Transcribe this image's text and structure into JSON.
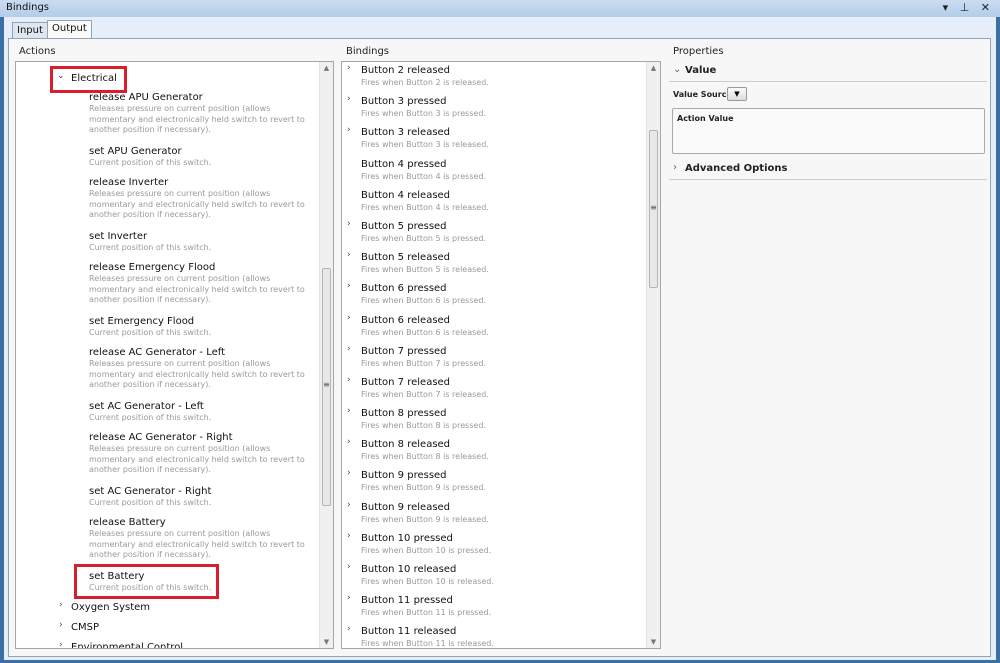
{
  "window": {
    "title": "Bindings",
    "controls": "▾ ⊥ ✕"
  },
  "tabs": [
    {
      "label": "Input"
    },
    {
      "label": "Output"
    }
  ],
  "actions": {
    "header": "Actions",
    "category": "Electrical",
    "items": [
      {
        "title": "release APU Generator",
        "desc": "Releases pressure on current position (allows momentary and electronically held switch to revert to another position if necessary).",
        "kind": "rel"
      },
      {
        "title": "set APU Generator",
        "desc": "Current position of this switch.",
        "kind": "set"
      },
      {
        "title": "release Inverter",
        "desc": "Releases pressure on current position (allows momentary and electronically held switch to revert to another position if necessary).",
        "kind": "rel"
      },
      {
        "title": "set Inverter",
        "desc": "Current position of this switch.",
        "kind": "set"
      },
      {
        "title": "release Emergency Flood",
        "desc": "Releases pressure on current position (allows momentary and electronically held switch to revert to another position if necessary).",
        "kind": "rel"
      },
      {
        "title": "set Emergency Flood",
        "desc": "Current position of this switch.",
        "kind": "set"
      },
      {
        "title": "release AC Generator - Left",
        "desc": "Releases pressure on current position (allows momentary and electronically held switch to revert to another position if necessary).",
        "kind": "rel"
      },
      {
        "title": "set AC Generator - Left",
        "desc": "Current position of this switch.",
        "kind": "set"
      },
      {
        "title": "release AC Generator - Right",
        "desc": "Releases pressure on current position (allows momentary and electronically held switch to revert to another position if necessary).",
        "kind": "rel"
      },
      {
        "title": "set AC Generator - Right",
        "desc": "Current position of this switch.",
        "kind": "set"
      },
      {
        "title": "release Battery",
        "desc": "Releases pressure on current position (allows momentary and electronically held switch to revert to another position if necessary).",
        "kind": "rel"
      },
      {
        "title": "set Battery",
        "desc": "Current position of this switch.",
        "kind": "set"
      }
    ],
    "categories_after": [
      "Oxygen System",
      "CMSP",
      "Environmental Control"
    ]
  },
  "bindings": {
    "header": "Bindings",
    "items": [
      {
        "title": "Button 2 released",
        "desc": "Fires when Button 2 is released.",
        "expandable": true
      },
      {
        "title": "Button 3 pressed",
        "desc": "Fires when Button 3 is pressed.",
        "expandable": true
      },
      {
        "title": "Button 3 released",
        "desc": "Fires when Button 3 is released.",
        "expandable": true
      },
      {
        "title": "Button 4 pressed",
        "desc": "Fires when Button 4 is pressed.",
        "expandable": false
      },
      {
        "title": "Button 4 released",
        "desc": "Fires when Button 4 is released.",
        "expandable": false
      },
      {
        "title": "Button 5 pressed",
        "desc": "Fires when Button 5 is pressed.",
        "expandable": true
      },
      {
        "title": "Button 5 released",
        "desc": "Fires when Button 5 is released.",
        "expandable": true
      },
      {
        "title": "Button 6 pressed",
        "desc": "Fires when Button 6 is pressed.",
        "expandable": true
      },
      {
        "title": "Button 6 released",
        "desc": "Fires when Button 6 is released.",
        "expandable": true
      },
      {
        "title": "Button 7 pressed",
        "desc": "Fires when Button 7 is pressed.",
        "expandable": true
      },
      {
        "title": "Button 7 released",
        "desc": "Fires when Button 7 is released.",
        "expandable": true
      },
      {
        "title": "Button 8 pressed",
        "desc": "Fires when Button 8 is pressed.",
        "expandable": true
      },
      {
        "title": "Button 8 released",
        "desc": "Fires when Button 8 is released.",
        "expandable": true
      },
      {
        "title": "Button 9 pressed",
        "desc": "Fires when Button 9 is pressed.",
        "expandable": true
      },
      {
        "title": "Button 9 released",
        "desc": "Fires when Button 9 is released.",
        "expandable": true
      },
      {
        "title": "Button 10 pressed",
        "desc": "Fires when Button 10 is pressed.",
        "expandable": true
      },
      {
        "title": "Button 10 released",
        "desc": "Fires when Button 10 is released.",
        "expandable": true
      },
      {
        "title": "Button 11 pressed",
        "desc": "Fires when Button 11 is pressed.",
        "expandable": true
      },
      {
        "title": "Button 11 released",
        "desc": "Fires when Button 11 is released.",
        "expandable": true
      }
    ]
  },
  "properties": {
    "header": "Properties",
    "value_section": "Value",
    "value_source_label": "Value Source",
    "action_value_label": "Action Value",
    "advanced_section": "Advanced Options"
  },
  "colors": {
    "highlight": "#d81e2a",
    "frame": "#3c6fa6"
  }
}
